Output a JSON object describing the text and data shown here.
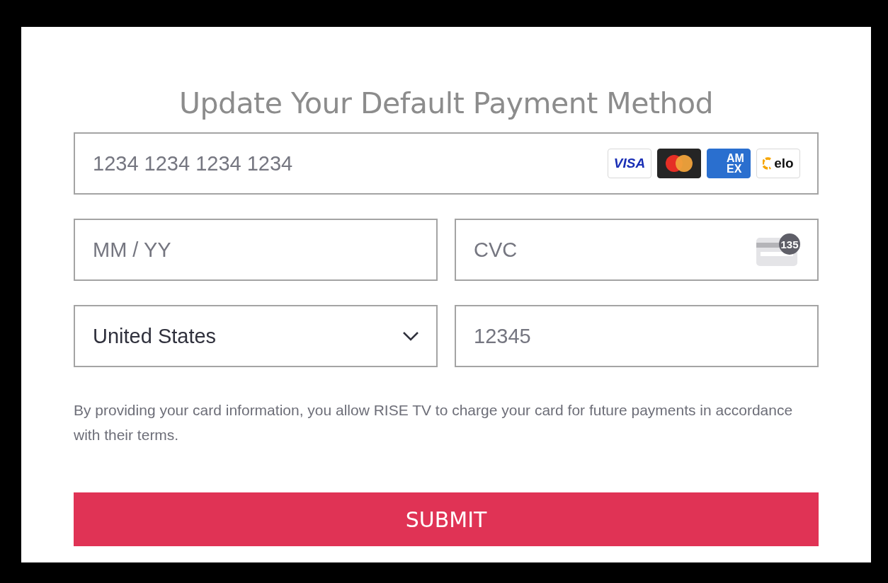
{
  "title": "Update Your Default Payment Method",
  "card_number": {
    "placeholder": "1234 1234 1234 1234",
    "brands": [
      {
        "kind": "visa",
        "label": "VISA"
      },
      {
        "kind": "mastercard"
      },
      {
        "kind": "amex",
        "label": "AM EX"
      },
      {
        "kind": "elo",
        "label": "elo"
      }
    ]
  },
  "expiry": {
    "placeholder": "MM / YY"
  },
  "cvc": {
    "placeholder": "CVC",
    "badge": "135"
  },
  "country": {
    "value": "United States"
  },
  "postal_code": {
    "placeholder": "12345"
  },
  "terms": "By providing your card information, you allow RISE TV to charge your card for future payments in accordance with their terms.",
  "submit": "SUBMIT"
}
